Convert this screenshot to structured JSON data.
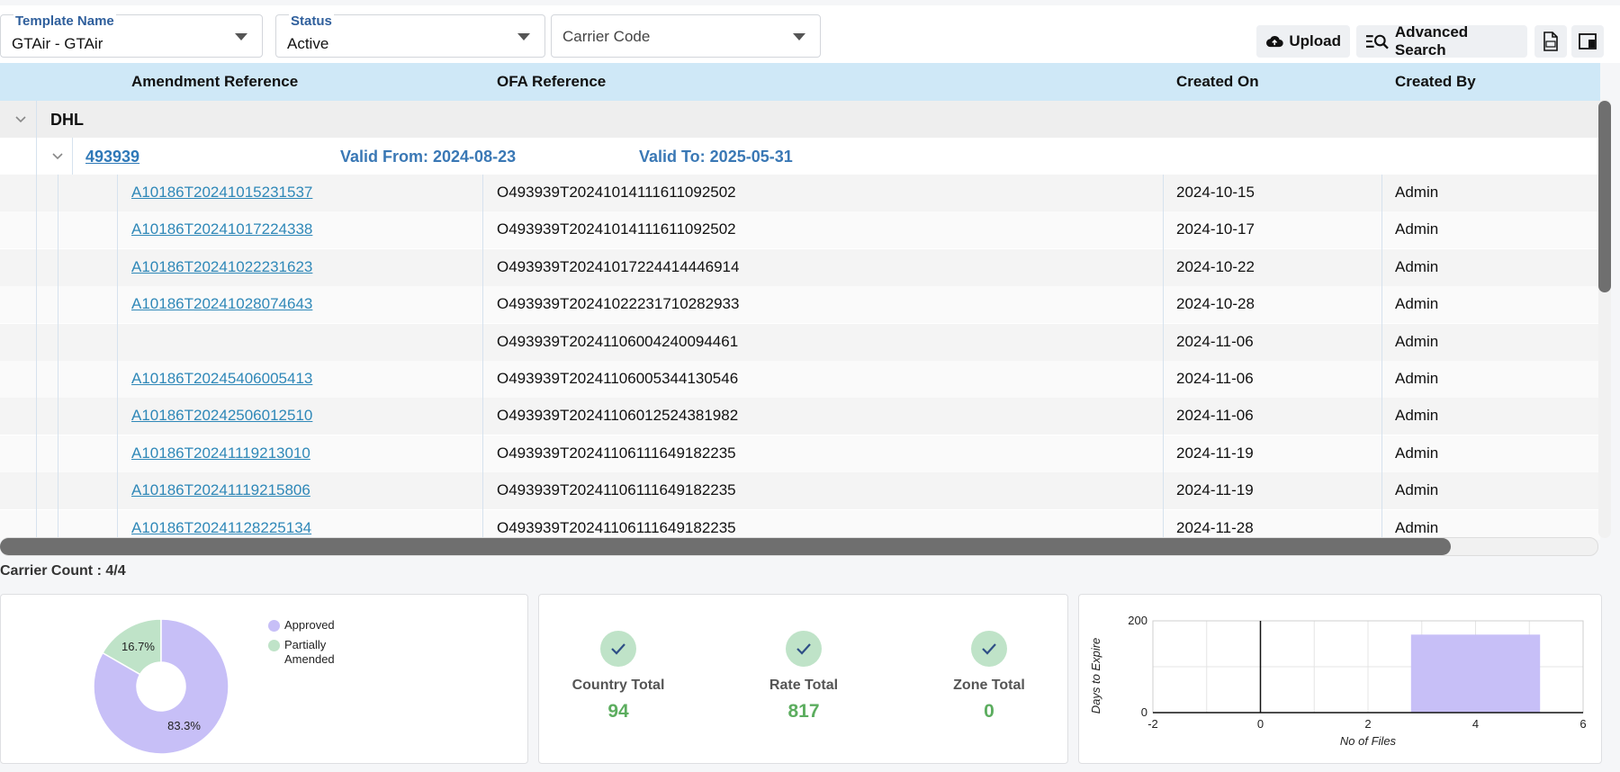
{
  "filters": {
    "template_name": {
      "label": "Template Name",
      "value": "GTAir - GTAir"
    },
    "status": {
      "label": "Status",
      "value": "Active"
    },
    "carrier_code": {
      "placeholder": "Carrier Code"
    }
  },
  "toolbar": {
    "upload_label": "Upload",
    "advanced_search_label": "Advanced Search"
  },
  "grid": {
    "headers": {
      "amendment_reference": "Amendment Reference",
      "ofa_reference": "OFA Reference",
      "created_on": "Created On",
      "created_by": "Created By"
    },
    "group": {
      "carrier": "DHL",
      "subgroup": {
        "reference": "493939",
        "valid_from": "Valid From: 2024-08-23",
        "valid_to": "Valid To: 2025-05-31"
      }
    },
    "rows": [
      {
        "amendment": "A10186T20241015231537",
        "ofa": "O493939T20241014111611092502",
        "created_on": "2024-10-15",
        "created_by": "Admin"
      },
      {
        "amendment": "A10186T20241017224338",
        "ofa": "O493939T20241014111611092502",
        "created_on": "2024-10-17",
        "created_by": "Admin"
      },
      {
        "amendment": "A10186T20241022231623",
        "ofa": "O493939T20241017224414446914",
        "created_on": "2024-10-22",
        "created_by": "Admin"
      },
      {
        "amendment": "A10186T20241028074643",
        "ofa": "O493939T20241022231710282933",
        "created_on": "2024-10-28",
        "created_by": "Admin"
      },
      {
        "amendment": "",
        "ofa": "O493939T20241106004240094461",
        "created_on": "2024-11-06",
        "created_by": "Admin"
      },
      {
        "amendment": "A10186T20245406005413",
        "ofa": "O493939T20241106005344130546",
        "created_on": "2024-11-06",
        "created_by": "Admin"
      },
      {
        "amendment": "A10186T20242506012510",
        "ofa": "O493939T20241106012524381982",
        "created_on": "2024-11-06",
        "created_by": "Admin"
      },
      {
        "amendment": "A10186T20241119213010",
        "ofa": "O493939T20241106111649182235",
        "created_on": "2024-11-19",
        "created_by": "Admin"
      },
      {
        "amendment": "A10186T20241119215806",
        "ofa": "O493939T20241106111649182235",
        "created_on": "2024-11-19",
        "created_by": "Admin"
      },
      {
        "amendment": "A10186T20241128225134",
        "ofa": "O493939T20241106111649182235",
        "created_on": "2024-11-28",
        "created_by": "Admin"
      }
    ]
  },
  "carrier_count": "Carrier Count : 4/4",
  "icons": {
    "upload": "cloud-upload-icon",
    "advanced_search": "list-search-icon",
    "export_csv": "csv-file-icon",
    "column_chooser": "column-panel-icon"
  },
  "colors": {
    "header_bg": "#cfe8f7",
    "link": "#2f88b8",
    "approved": "#c7bff7",
    "partially_amended": "#bfe3c8",
    "stat_value": "#5cad5f"
  },
  "stats": [
    {
      "label": "Country Total",
      "value": "94"
    },
    {
      "label": "Rate Total",
      "value": "817"
    },
    {
      "label": "Zone Total",
      "value": "0"
    }
  ],
  "chart_data": [
    {
      "type": "pie",
      "donut": true,
      "labels": [
        "Approved",
        "Partially Amended"
      ],
      "values": [
        83.3,
        16.7
      ],
      "data_labels": [
        "83.3%",
        "16.7%"
      ],
      "colors": [
        "#c7bff7",
        "#bfe3c8"
      ],
      "legend_placement": "top-right"
    },
    {
      "type": "bar",
      "xlabel": "No of Files",
      "ylabel": "Days to Expire",
      "xlim": [
        -2,
        6
      ],
      "ylim": [
        0,
        200
      ],
      "x_ticks": [
        -2,
        0,
        2,
        4,
        6
      ],
      "y_ticks": [
        0,
        200
      ],
      "bars": [
        {
          "x_start": 2.8,
          "x_end": 5.2,
          "value": 170
        }
      ],
      "grid": true,
      "color": "#c7bff7"
    }
  ]
}
